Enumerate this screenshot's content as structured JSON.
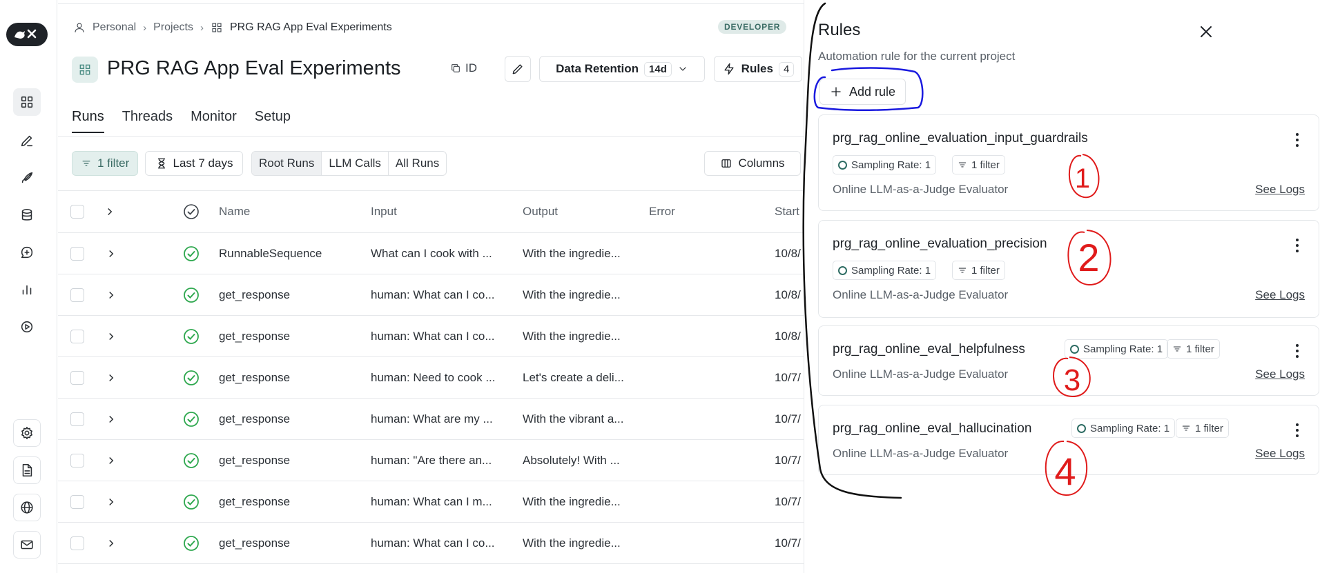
{
  "breadcrumb": {
    "items": [
      "Personal",
      "Projects",
      "PRG RAG App Eval Experiments"
    ]
  },
  "badge": "DEVELOPER",
  "project": {
    "title": "PRG RAG App Eval Experiments",
    "id_label": "ID",
    "retention_label": "Data Retention",
    "retention_value": "14d",
    "rules_label": "Rules",
    "rules_count": "4"
  },
  "tabs": [
    "Runs",
    "Threads",
    "Monitor",
    "Setup"
  ],
  "toolbar": {
    "filter_label": "1 filter",
    "time_label": "Last 7 days",
    "segments": [
      "Root Runs",
      "LLM Calls",
      "All Runs"
    ],
    "columns_label": "Columns"
  },
  "table": {
    "headers": [
      "Name",
      "Input",
      "Output",
      "Error",
      "Start"
    ],
    "rows": [
      {
        "name": "RunnableSequence",
        "input": "What can I cook with ...",
        "output": "With the ingredie...",
        "start": "10/8/"
      },
      {
        "name": "get_response",
        "input": "human: What can I co...",
        "output": "With the ingredie...",
        "start": "10/8/"
      },
      {
        "name": "get_response",
        "input": "human: What can I co...",
        "output": "With the ingredie...",
        "start": "10/8/"
      },
      {
        "name": "get_response",
        "input": "human: Need to cook ...",
        "output": "Let's create a deli...",
        "start": "10/7/"
      },
      {
        "name": "get_response",
        "input": "human: What are my ...",
        "output": "With the vibrant a...",
        "start": "10/7/"
      },
      {
        "name": "get_response",
        "input": "human: \"Are there an...",
        "output": "Absolutely! With ...",
        "start": "10/7/"
      },
      {
        "name": "get_response",
        "input": "human: What can I m...",
        "output": "With the ingredie...",
        "start": "10/7/"
      },
      {
        "name": "get_response",
        "input": "human: What can I co...",
        "output": "With the ingredie...",
        "start": "10/7/"
      }
    ]
  },
  "rules_panel": {
    "title": "Rules",
    "subtitle": "Automation rule for the current project",
    "add_label": "Add rule",
    "rules": [
      {
        "name": "prg_rag_online_evaluation_input_guardrails",
        "sampling": "Sampling Rate: 1",
        "filter": "1 filter",
        "type": "Online LLM-as-a-Judge Evaluator",
        "logs": "See Logs"
      },
      {
        "name": "prg_rag_online_evaluation_precision",
        "sampling": "Sampling Rate: 1",
        "filter": "1 filter",
        "type": "Online LLM-as-a-Judge Evaluator",
        "logs": "See Logs"
      },
      {
        "name": "prg_rag_online_eval_helpfulness",
        "sampling": "Sampling Rate: 1",
        "filter": "1 filter",
        "type": "Online LLM-as-a-Judge Evaluator",
        "logs": "See Logs"
      },
      {
        "name": "prg_rag_online_eval_hallucination",
        "sampling": "Sampling Rate: 1",
        "filter": "1 filter",
        "type": "Online LLM-as-a-Judge Evaluator",
        "logs": "See Logs"
      }
    ]
  },
  "annotations": {
    "numbers": [
      "1",
      "2",
      "3",
      "4"
    ],
    "color": "#e01b1b",
    "highlight_color": "#1a1adf"
  },
  "colors": {
    "accent": "#3a6b64",
    "success": "#2fa84f"
  }
}
